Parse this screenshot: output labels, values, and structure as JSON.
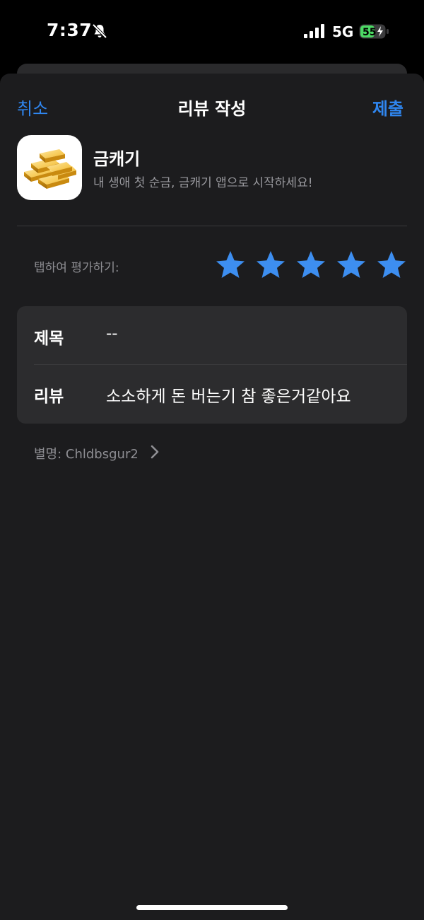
{
  "status_bar": {
    "time": "7:37",
    "network": "5G",
    "battery": "55",
    "icons": [
      "bell-slash-icon",
      "signal-icon",
      "battery-charging-icon"
    ]
  },
  "nav": {
    "cancel_label": "취소",
    "title": "리뷰 작성",
    "submit_label": "제출"
  },
  "app": {
    "name": "금캐기",
    "subtitle": "내 생애 첫 순금, 금캐기 앱으로 시작하세요!",
    "icon": "gold-bars-icon"
  },
  "rating": {
    "label": "탭하여 평가하기:",
    "value": 5,
    "max": 5,
    "star_color": "#3d8ef0"
  },
  "form": {
    "title_label": "제목",
    "title_value": "--",
    "review_label": "리뷰",
    "review_value": "소소하게 돈 버는기 참 좋은거같아요"
  },
  "nickname": "별명: Chldbsgur2",
  "colors": {
    "accent": "#2f86f0",
    "sheet_bg": "#1c1c1e",
    "card_bg": "#2c2c2e"
  }
}
